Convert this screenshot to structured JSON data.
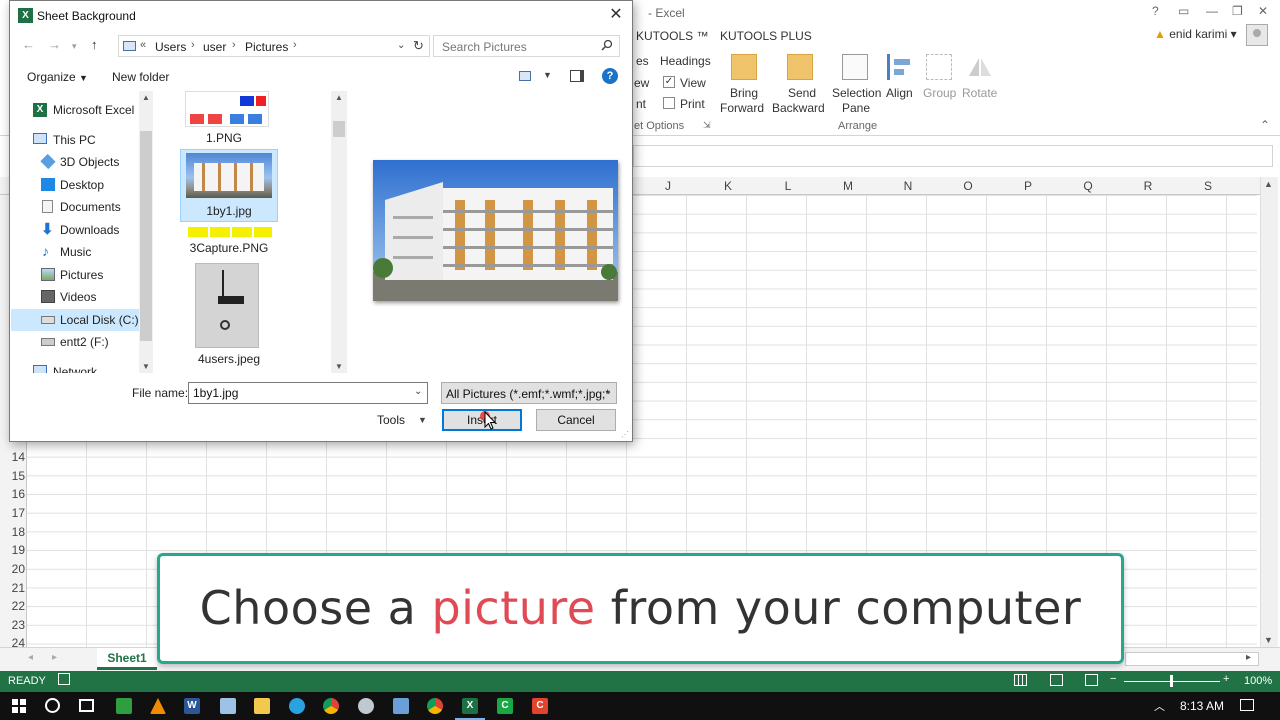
{
  "excel": {
    "app_name": "- Excel",
    "tabs": [
      "KUTOOLS ™",
      "KUTOOLS PLUS"
    ],
    "user_name": "enid karimi",
    "ribbon": {
      "headings_label": "Headings",
      "view_label": "View",
      "print_label": "Print",
      "es_fragment": "es",
      "ew_fragment": "ew",
      "nt_fragment": "nt",
      "sheet_options_label": "et Options",
      "bring_forward": [
        "Bring",
        "Forward"
      ],
      "send_backward": [
        "Send",
        "Backward"
      ],
      "selection_pane": [
        "Selection",
        "Pane"
      ],
      "align_label": "Align",
      "group_label": "Group",
      "rotate_label": "Rotate",
      "arrange_label": "Arrange"
    },
    "columns": [
      "J",
      "K",
      "L",
      "M",
      "N",
      "O",
      "P",
      "Q",
      "R",
      "S"
    ],
    "rows": [
      "14",
      "15",
      "16",
      "17",
      "18",
      "19",
      "20",
      "21",
      "22",
      "23",
      "24"
    ],
    "sheet_tab": "Sheet1",
    "status": "READY",
    "zoom": "100%"
  },
  "caption": {
    "part1": "Choose a ",
    "highlight": "picture",
    "part2": " from your computer"
  },
  "dialog": {
    "title": "Sheet Background",
    "breadcrumb": [
      "Users",
      "user",
      "Pictures"
    ],
    "breadcrumb_prefix": "«",
    "search_placeholder": "Search Pictures",
    "organize_label": "Organize",
    "new_folder_label": "New folder",
    "nav_items": [
      {
        "label": "Microsoft Excel",
        "icon": "excel-icon"
      },
      {
        "label": "This PC",
        "icon": "pc-icon"
      },
      {
        "label": "3D Objects",
        "icon": "3d-objects-icon"
      },
      {
        "label": "Desktop",
        "icon": "desktop-icon"
      },
      {
        "label": "Documents",
        "icon": "documents-icon"
      },
      {
        "label": "Downloads",
        "icon": "downloads-icon"
      },
      {
        "label": "Music",
        "icon": "music-icon"
      },
      {
        "label": "Pictures",
        "icon": "pictures-icon"
      },
      {
        "label": "Videos",
        "icon": "videos-icon"
      },
      {
        "label": "Local Disk (C:)",
        "icon": "disk-icon"
      },
      {
        "label": "entt2 (F:)",
        "icon": "drive-icon"
      },
      {
        "label": "Network",
        "icon": "network-icon"
      }
    ],
    "files": [
      {
        "name": "1.PNG"
      },
      {
        "name": "1by1.jpg",
        "selected": true
      },
      {
        "name": "3Capture.PNG"
      },
      {
        "name": "4users.jpeg"
      }
    ],
    "file_name_label": "File name:",
    "file_name_value": "1by1.jpg",
    "file_type": "All Pictures (*.emf;*.wmf;*.jpg;*",
    "tools_label": "Tools",
    "insert_label": "Insert",
    "cancel_label": "Cancel"
  },
  "taskbar": {
    "clock": "8:13 AM"
  }
}
